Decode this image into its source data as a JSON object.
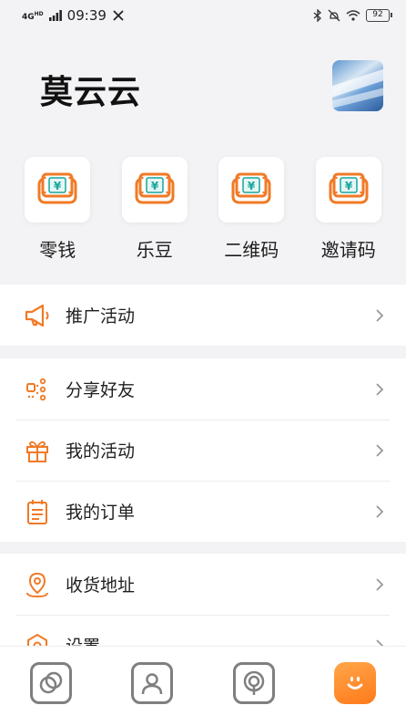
{
  "status_bar": {
    "network_badge_top": "4G",
    "network_badge_sup": "HD",
    "time": "09:39",
    "battery": "92"
  },
  "profile": {
    "name": "莫云云"
  },
  "quick_actions": [
    {
      "label": "零钱",
      "icon": "wallet-icon"
    },
    {
      "label": "乐豆",
      "icon": "wallet-icon"
    },
    {
      "label": "二维码",
      "icon": "wallet-icon"
    },
    {
      "label": "邀请码",
      "icon": "wallet-icon"
    }
  ],
  "menu": {
    "promo": {
      "label": "推广活动",
      "icon": "megaphone-icon"
    },
    "group2": [
      {
        "label": "分享好友",
        "icon": "share-icon"
      },
      {
        "label": "我的活动",
        "icon": "gift-icon"
      },
      {
        "label": "我的订单",
        "icon": "order-icon"
      }
    ],
    "group3": [
      {
        "label": "收货地址",
        "icon": "location-icon"
      },
      {
        "label": "设置",
        "icon": "settings-icon"
      }
    ]
  },
  "bottom_nav": [
    {
      "name": "discover",
      "icon": "rings-icon"
    },
    {
      "name": "contacts",
      "icon": "person-icon"
    },
    {
      "name": "broadcast",
      "icon": "broadcast-icon"
    },
    {
      "name": "me",
      "icon": "smiley-icon",
      "active": true
    }
  ],
  "colors": {
    "accent": "#f07a26",
    "accent_light": "#ffa64a",
    "teal": "#16a79e",
    "background": "#f3f3f5"
  }
}
